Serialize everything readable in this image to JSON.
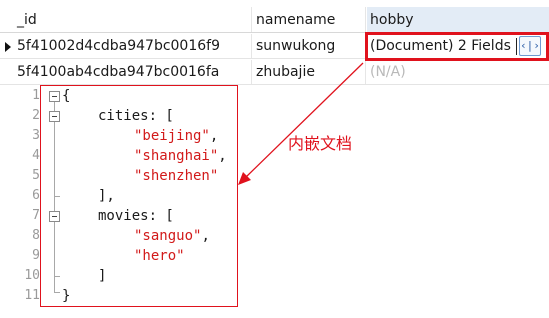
{
  "grid": {
    "columns": [
      "_id",
      "namename",
      "hobby"
    ],
    "rows": [
      {
        "_id": "5f41002d4cdba947bc0016f9",
        "namename": "sunwukong",
        "hobby": "(Document) 2 Fields",
        "selected": true
      },
      {
        "_id": "5f4100ab4cdba947bc0016fa",
        "namename": "zhubajie",
        "hobby": "(N/A)",
        "selected": false
      }
    ],
    "edit_button_glyph": "‹|›"
  },
  "editor": {
    "line_numbers": [
      "1",
      "2",
      "3",
      "4",
      "5",
      "6",
      "7",
      "8",
      "9",
      "10",
      "11"
    ],
    "lines": {
      "l1": "{",
      "l2": "cities: [",
      "l3": "\"beijing\"",
      "l4": "\"shanghai\"",
      "l5": "\"shenzhen\"",
      "l6": "],",
      "l7": "movies: [",
      "l8": "\"sanguo\"",
      "l9": "\"hero\"",
      "l10": "]",
      "l11": "}"
    },
    "comma": ","
  },
  "annotation": {
    "text": "内嵌文档",
    "color": "#e0121d"
  },
  "colors": {
    "highlight": "#e0121d",
    "string": "#d21a1a",
    "header_selected": "#e3ecf6"
  },
  "icons": {
    "row_marker": "triangle-right-icon",
    "edit": "code-edit-icon",
    "fold": "fold-minus-icon"
  }
}
